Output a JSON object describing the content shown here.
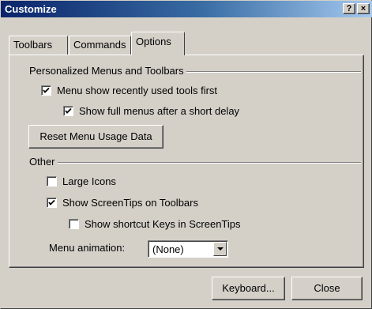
{
  "window": {
    "title": "Customize"
  },
  "titlebar_buttons": {
    "help": "?",
    "close": "×"
  },
  "tabs": [
    {
      "label": "Toolbars"
    },
    {
      "label": "Commands"
    },
    {
      "label": "Options"
    }
  ],
  "personalized": {
    "group_label": "Personalized Menus and Toolbars",
    "recent_first": {
      "label": "Menu show recently used tools first",
      "checked": true
    },
    "full_menus_delay": {
      "label": "Show full menus after a short delay",
      "checked": true
    },
    "reset_button": "Reset Menu Usage Data"
  },
  "other": {
    "group_label": "Other",
    "large_icons": {
      "label": "Large Icons",
      "checked": false
    },
    "screentips": {
      "label": "Show ScreenTips on Toolbars",
      "checked": true
    },
    "shortcut_keys": {
      "label": "Show shortcut Keys in ScreenTips",
      "checked": false
    },
    "animation_label": "Menu animation:",
    "animation_value": "(None)"
  },
  "footer": {
    "keyboard_button": "Keyboard...",
    "close_button": "Close"
  }
}
